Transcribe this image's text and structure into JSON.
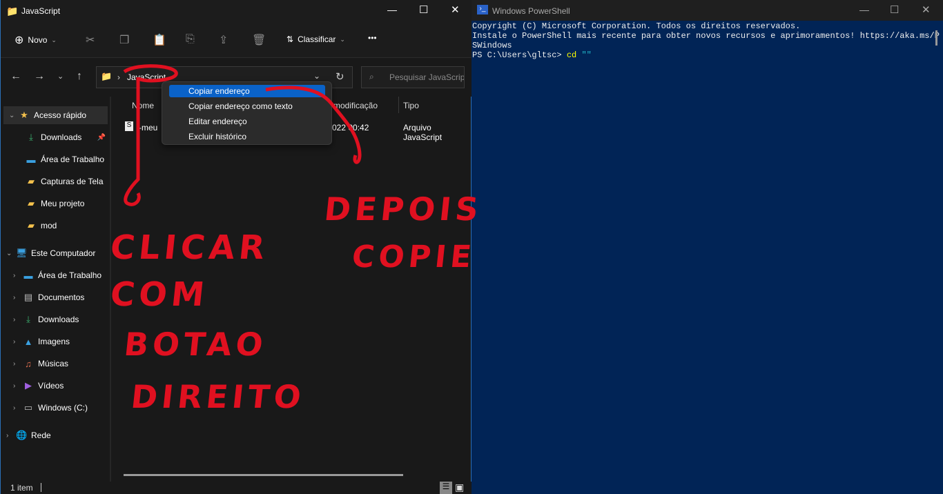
{
  "explorer": {
    "title": "JavaScript",
    "toolbar": {
      "new_label": "Novo",
      "sort_label": "Classificar",
      "more": "•••"
    },
    "address": {
      "segment": "JavaScript"
    },
    "search_placeholder": "Pesquisar JavaScript",
    "context_menu": [
      "Copiar endereço",
      "Copiar endereço como texto",
      "Editar endereço",
      "Excluir histórico"
    ],
    "columns": {
      "name": "Nome",
      "modified": "modificação",
      "type": "Tipo"
    },
    "file": {
      "name": "-meu",
      "modified": "022 00:42",
      "type": "Arquivo JavaScript"
    },
    "sidebar": [
      {
        "label": "Acesso rápido",
        "icon": "star-icon"
      },
      {
        "label": "Downloads",
        "icon": "download-icon"
      },
      {
        "label": "Área de Trabalho",
        "icon": "desktop-icon"
      },
      {
        "label": "Capturas de Tela",
        "icon": "folder-icon"
      },
      {
        "label": "Meu projeto",
        "icon": "folder-icon"
      },
      {
        "label": "mod",
        "icon": "folder-icon"
      },
      {
        "label": "Este Computador",
        "icon": "computer-icon"
      },
      {
        "label": "Área de Trabalho",
        "icon": "desktop-icon"
      },
      {
        "label": "Documentos",
        "icon": "document-icon"
      },
      {
        "label": "Downloads",
        "icon": "download-icon"
      },
      {
        "label": "Imagens",
        "icon": "image-icon"
      },
      {
        "label": "Músicas",
        "icon": "music-icon"
      },
      {
        "label": "Vídeos",
        "icon": "video-icon"
      },
      {
        "label": "Windows (C:)",
        "icon": "drive-icon"
      },
      {
        "label": "Rede",
        "icon": "network-icon"
      }
    ],
    "status": "1 item"
  },
  "powershell": {
    "title": "Windows PowerShell",
    "lines": [
      "Copyright (C) Microsoft Corporation. Todos os direitos reservados.",
      "",
      "Instale o PowerShell mais recente para obter novos recursos e aprimoramentos! https://aka.ms/P",
      "SWindows",
      ""
    ],
    "prompt": "PS C:\\Users\\gltsc> ",
    "command": "cd",
    "arg": "\"\"",
    "bg": "#012456"
  },
  "annotation": {
    "left": [
      "CLICAR",
      "COM",
      "BOTAO",
      "DIREITO"
    ],
    "right": [
      "DEPOIS",
      "COPIE"
    ],
    "color": "#e01020"
  }
}
